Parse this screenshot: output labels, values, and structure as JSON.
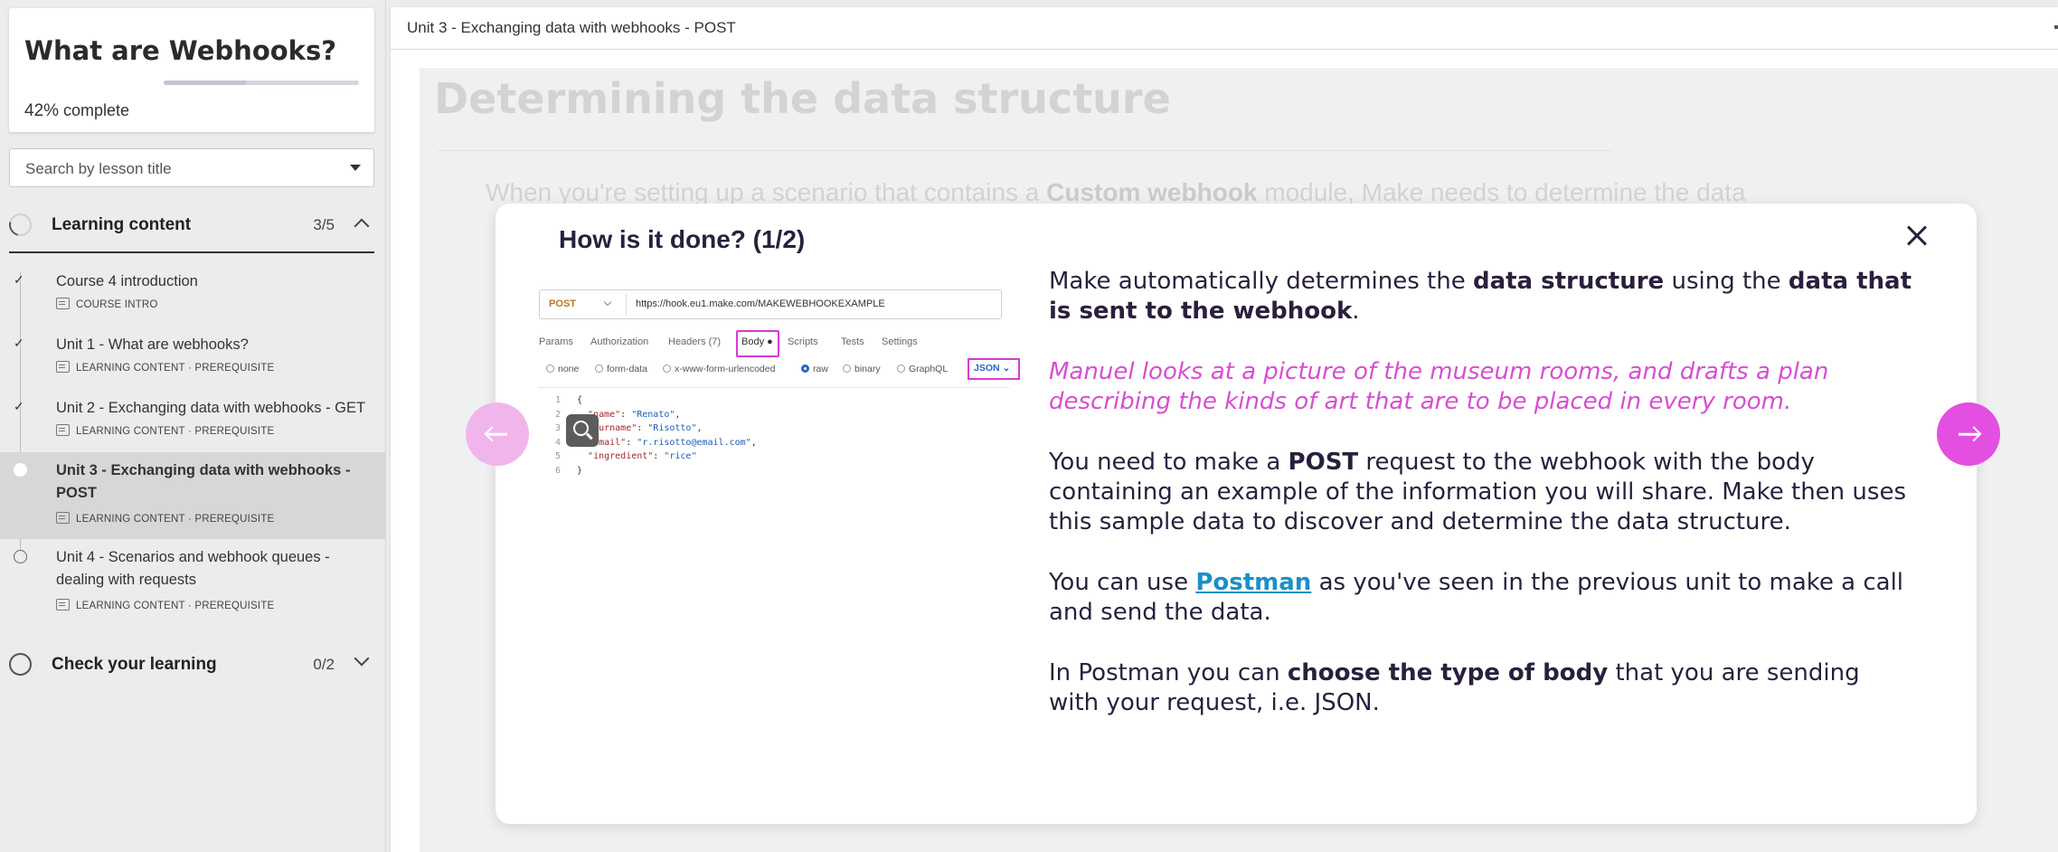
{
  "sidebar": {
    "course_title": "What are Webhooks?",
    "progress_percent": 42,
    "progress_pct_label": "42%",
    "progress_suffix": " complete",
    "search_placeholder": "Search by lesson title",
    "sections": [
      {
        "title": "Learning content",
        "count": "3/5",
        "expanded": true
      },
      {
        "title": "Check your learning",
        "count": "0/2",
        "expanded": false
      }
    ],
    "lessons": [
      {
        "title": "Course 4 introduction",
        "meta": "COURSE INTRO",
        "status": "done"
      },
      {
        "title": "Unit 1 - What are webhooks?",
        "meta": "LEARNING CONTENT · PREREQUISITE",
        "status": "done"
      },
      {
        "title": "Unit 2 - Exchanging data with webhooks - GET",
        "meta": "LEARNING CONTENT · PREREQUISITE",
        "status": "done"
      },
      {
        "title": "Unit 3 - Exchanging data with webhooks - POST",
        "meta": "LEARNING CONTENT · PREREQUISITE",
        "status": "current"
      },
      {
        "title": "Unit 4 - Scenarios and webhook queues - dealing with requests",
        "meta": "LEARNING CONTENT · PREREQUISITE",
        "status": "todo"
      }
    ]
  },
  "topbar": {
    "unit_title": "Unit 3 - Exchanging data with webhooks - POST"
  },
  "background": {
    "heading": "Determining the data structure",
    "para_start": "When you're setting up a scenario that contains a ",
    "para_bold": "Custom webhook",
    "para_end": " module, Make needs to determine the data"
  },
  "modal": {
    "title": "How is it done? (1/2)",
    "postman": {
      "method": "POST",
      "url": "https://hook.eu1.make.com/MAKEWEBHOOKEXAMPLE",
      "tabs": [
        "Params",
        "Authorization",
        "Headers (7)",
        "Body ●",
        "Scripts",
        "Tests",
        "Settings"
      ],
      "body_types": [
        "none",
        "form-data",
        "x-www-form-urlencoded",
        "raw",
        "binary",
        "GraphQL"
      ],
      "selected_body_type": "raw",
      "format": "JSON",
      "line_numbers": [
        "1",
        "2",
        "3",
        "4",
        "5",
        "6"
      ],
      "code": {
        "open": "{",
        "k1": "\"name\"",
        "v1": "\"Renato\"",
        "k2": "\"surname\"",
        "v2": "\"Risotto\"",
        "k3": "\"email\"",
        "v3": "\"r.risotto@email.com\"",
        "k4": "\"ingredient\"",
        "v4": "\"rice\"",
        "close": "}"
      }
    },
    "p1": {
      "a": "Make automatically determines the ",
      "b1": "data structure",
      "c": " using the ",
      "b2": "data that is sent to the webhook",
      "d": "."
    },
    "p2": "Manuel looks at a picture of the museum rooms, and drafts a plan describing the kinds of art that are to be placed in every room.",
    "p3": {
      "a": "You need to make a ",
      "b": "POST",
      "c": " request to the webhook with the body containing an example of the information you will share. Make then uses this sample data to discover and determine the data structure."
    },
    "p4": {
      "a": "You can use ",
      "link": "Postman",
      "c": " as you've seen in the previous unit to make a call and send the data."
    },
    "p5": {
      "a": "In Postman you can ",
      "b": "choose the type of body",
      "c": " that you are sending with your request, i.e. JSON."
    }
  },
  "colors": {
    "accent": "#e34fe0",
    "accent_light": "#f0b6ec",
    "link": "#1b8fc8",
    "text_dark": "#2a1f3d"
  },
  "icons": {
    "close": "close-icon",
    "prev": "arrow-left-icon",
    "next": "arrow-right-icon",
    "zoom": "zoom-in-icon"
  }
}
